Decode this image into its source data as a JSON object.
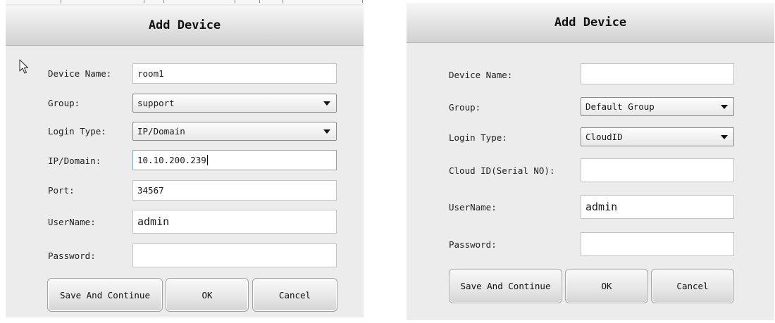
{
  "left_dialog": {
    "title": "Add Device",
    "labels": {
      "device_name": "Device Name:",
      "group": "Group:",
      "login_type": "Login Type:",
      "ip_domain": "IP/Domain:",
      "port": "Port:",
      "username": "UserName:",
      "password": "Password:"
    },
    "values": {
      "device_name": "room1",
      "group": "support",
      "login_type": "IP/Domain",
      "ip_domain": "10.10.200.239",
      "port": "34567",
      "username": "admin",
      "password": ""
    },
    "buttons": {
      "save_continue": "Save And Continue",
      "ok": "OK",
      "cancel": "Cancel"
    }
  },
  "right_dialog": {
    "title": "Add Device",
    "labels": {
      "device_name": "Device Name:",
      "group": "Group:",
      "login_type": "Login Type:",
      "cloud_id": "Cloud ID(Serial NO):",
      "username": "UserName:",
      "password": "Password:"
    },
    "values": {
      "device_name": "",
      "group": "Default Group",
      "login_type": "CloudID",
      "cloud_id": "",
      "username": "admin",
      "password": ""
    },
    "buttons": {
      "save_continue": "Save And Continue",
      "ok": "OK",
      "cancel": "Cancel"
    }
  },
  "icons": {
    "cursor": "mouse-pointer-icon",
    "dropdown": "chevron-down-icon"
  },
  "colors": {
    "panel_bg": "#ececec",
    "focus_border": "#7fa4d6"
  }
}
